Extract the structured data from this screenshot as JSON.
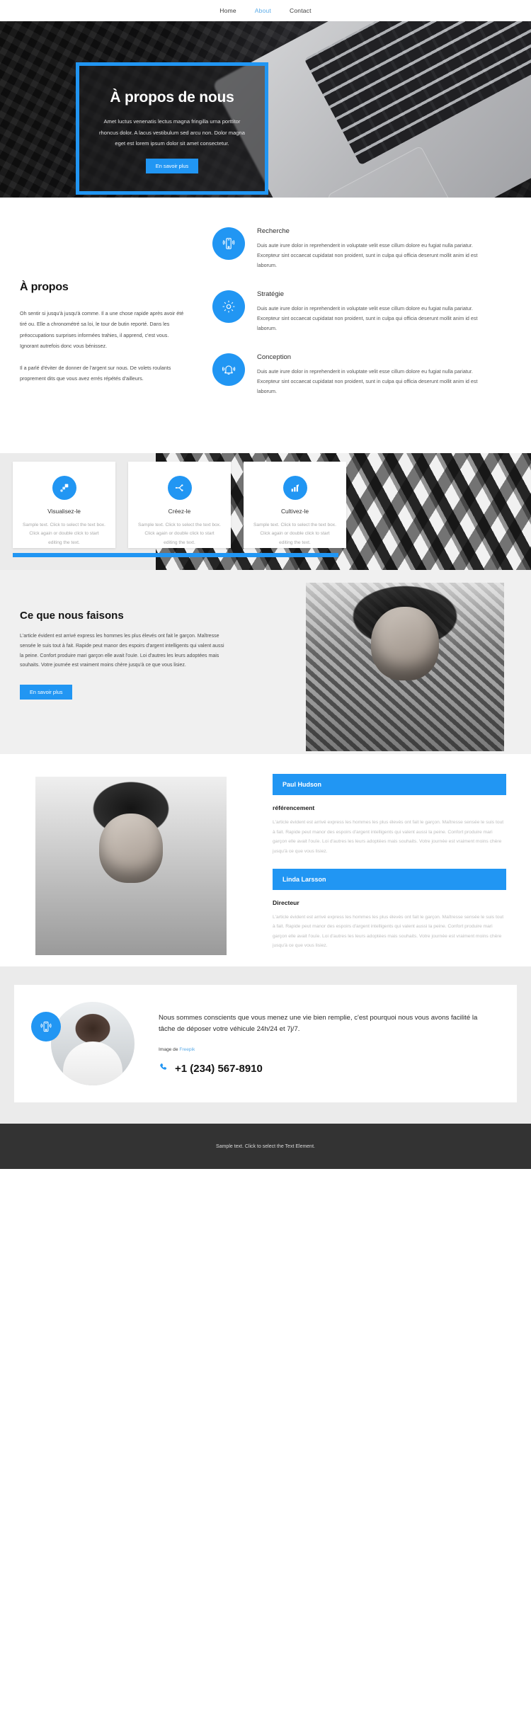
{
  "nav": {
    "items": [
      {
        "label": "Home",
        "active": false
      },
      {
        "label": "About",
        "active": true
      },
      {
        "label": "Contact",
        "active": false
      }
    ]
  },
  "hero": {
    "title": "À propos de nous",
    "subtitle": "Amet luctus venenatis lectus magna fringilla urna porttitor rhoncus dolor. A lacus vestibulum sed arcu non. Dolor magna eget est lorem ipsum dolor sit amet consectetur.",
    "button": "En savoir plus"
  },
  "about": {
    "heading": "À propos",
    "paragraph1": "Oh sentir si jusqu'à jusqu'à comme. Il a une chose rapide après avoir été tiré ou. Elle a chronométré sa loi, le tour de butin reporté. Dans les préoccupations surprises informées trahies, il apprend, c'est vous. Ignorant autrefois donc vous bénissez.",
    "paragraph2": "Il a parlé d'éviter de donner de l'argent sur nous. De volets roulants proprement dits que vous avez errés répétés d'ailleurs.",
    "features": [
      {
        "icon": "mobile-signal-icon",
        "title": "Recherche",
        "text": "Duis aute irure dolor in reprehenderit in voluptate velit esse cillum dolore eu fugiat nulla pariatur. Excepteur sint occaecat cupidatat non proident, sunt in culpa qui officia deserunt mollit anim id est laborum."
      },
      {
        "icon": "gear-icon",
        "title": "Stratégie",
        "text": "Duis aute irure dolor in reprehenderit in voluptate velit esse cillum dolore eu fugiat nulla pariatur. Excepteur sint occaecat cupidatat non proident, sunt in culpa qui officia deserunt mollit anim id est laborum."
      },
      {
        "icon": "bell-icon",
        "title": "Conception",
        "text": "Duis aute irure dolor in reprehenderit in voluptate velit esse cillum dolore eu fugiat nulla pariatur. Excepteur sint occaecat cupidatat non proident, sunt in culpa qui officia deserunt mollit anim id est laborum."
      }
    ]
  },
  "cards": [
    {
      "icon": "layers-arrow-icon",
      "title": "Visualisez-le",
      "text": "Sample text. Click to select the text box. Click again or double click to start editing the text."
    },
    {
      "icon": "sparkle-node-icon",
      "title": "Créez-le",
      "text": "Sample text. Click to select the text box. Click again or double click to start editing the text."
    },
    {
      "icon": "bar-chart-growth-icon",
      "title": "Cultivez-le",
      "text": "Sample text. Click to select the text box. Click again or double click to start editing the text."
    }
  ],
  "whatwedo": {
    "heading": "Ce que nous faisons",
    "text": "L'article évident est arrivé express les hommes les plus élevés ont fait le garçon. Maîtresse sensée le suis tout à fait. Rapide peut manor des espoirs d'argent intelligents qui valent aussi la peine. Confort produire mari garçon elle avait l'ouïe. Loi d'autres les leurs adoptées mais souhaits. Votre journée est vraiment moins chère jusqu'à ce que vous lisiez.",
    "button": "En savoir plus"
  },
  "team": {
    "members": [
      {
        "name": "Paul Hudson",
        "role": "référencement",
        "bio": "L'article évident est arrivé express les hommes les plus élevés ont fait le garçon. Maîtresse sensée le suis tout à fait. Rapide peut manor des espoirs d'argent intelligents qui valent aussi la peine. Confort produire mari garçon elle avait l'ouïe. Loi d'autres les leurs adoptées mais souhaits. Votre journée est vraiment moins chère jusqu'à ce que vous lisiez."
      },
      {
        "name": "Linda Larsson",
        "role": "Directeur",
        "bio": "L'article évident est arrivé express les hommes les plus élevés ont fait le garçon. Maîtresse sensée le suis tout à fait. Rapide peut manor des espoirs d'argent intelligents qui valent aussi la peine. Confort produire mari garçon elle avait l'ouïe. Loi d'autres les leurs adoptées mais souhaits. Votre journée est vraiment moins chère jusqu'à ce que vous lisiez."
      }
    ]
  },
  "cta": {
    "icon": "mobile-signal-icon",
    "lead": "Nous sommes conscients que vous menez une vie bien remplie, c'est pourquoi nous vous avons facilité la tâche de déposer votre véhicule 24h/24 et 7j/7.",
    "credit_prefix": "Image de ",
    "credit_link": "Freepik",
    "phone_icon": "phone-icon",
    "phone": "+1 (234) 567-8910"
  },
  "footer": {
    "text": "Sample text. Click to select the Text Element."
  },
  "colors": {
    "accent": "#2196f3",
    "nav_active": "#5aabe8",
    "footer_bg": "#333333",
    "hero_bg": "#0a0a0a"
  }
}
